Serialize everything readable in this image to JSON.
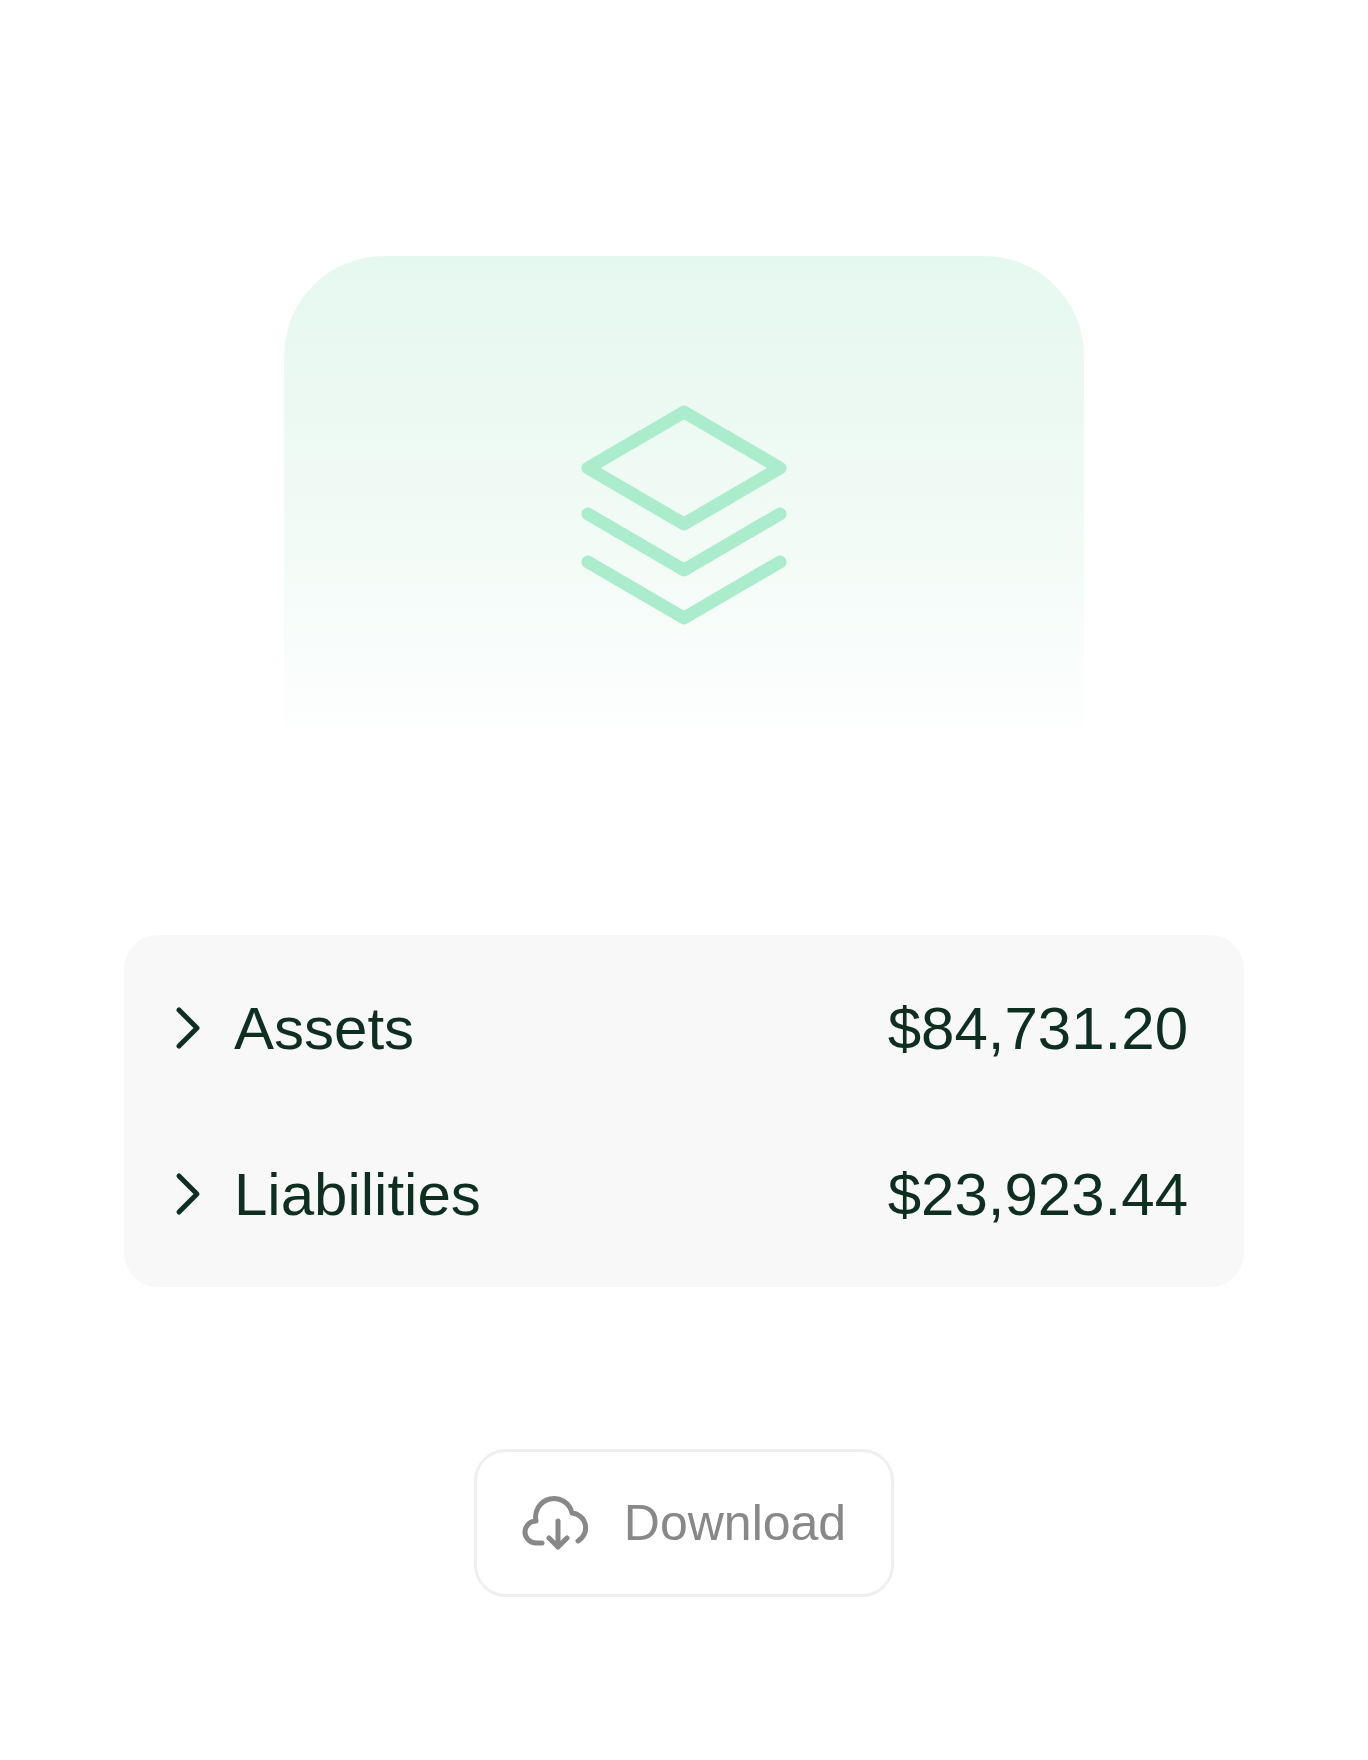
{
  "accounts": [
    {
      "label": "Assets",
      "amount": "$84,731.20",
      "expanded": false
    },
    {
      "label": "Liabilities",
      "amount": "$23,923.44",
      "expanded": false
    }
  ],
  "download_button": {
    "label": "Download"
  }
}
